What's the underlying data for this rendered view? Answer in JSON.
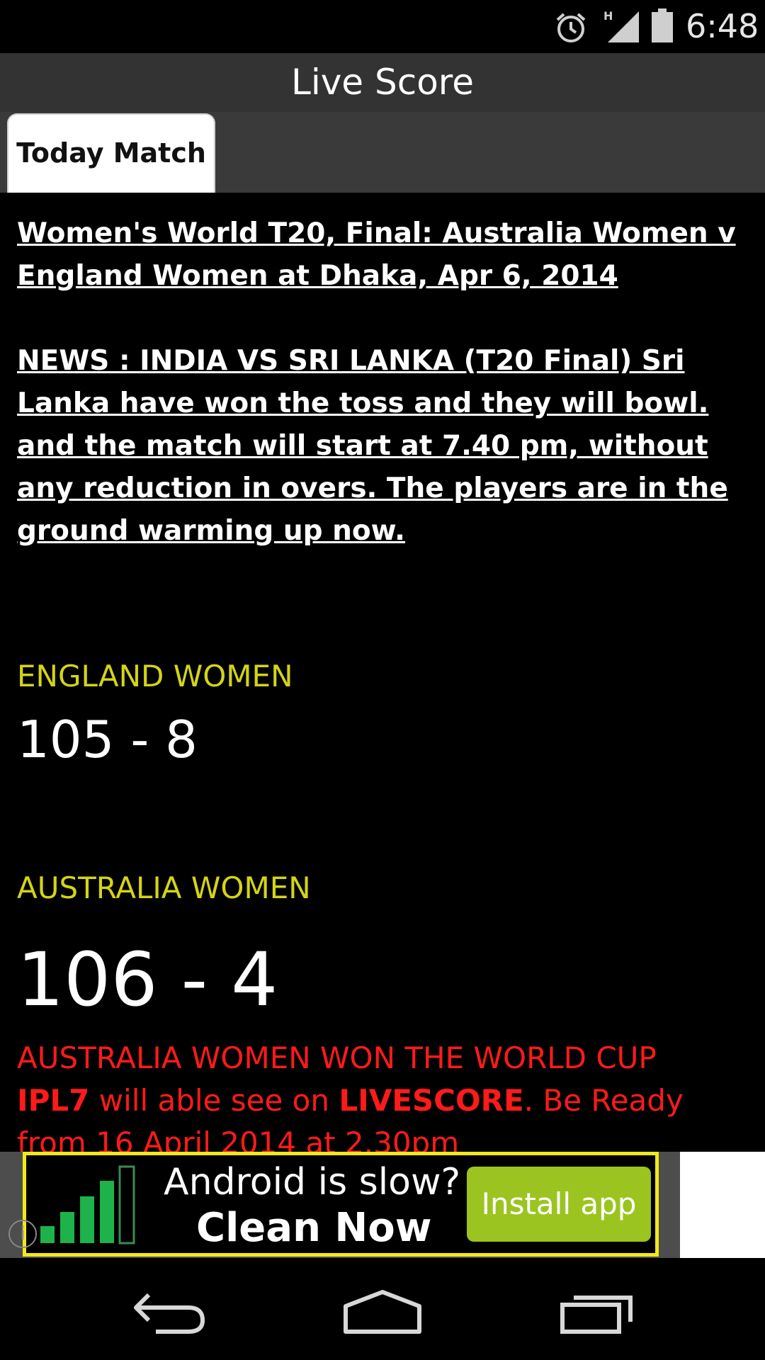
{
  "status_bar": {
    "time": "6:48",
    "network_label": "H",
    "icons": [
      "alarm-icon",
      "signal-icon",
      "battery-icon"
    ]
  },
  "action_bar": {
    "title": "Live Score"
  },
  "tabs": [
    {
      "label": "Today Match",
      "selected": true
    }
  ],
  "match": {
    "headline": "Women's World T20, Final: Australia Women v England Women at Dhaka, Apr 6, 2014",
    "news": "NEWS : INDIA VS SRI LANKA (T20 Final) Sri Lanka have won the toss and they will bowl. and the match will start at 7.40 pm, without any reduction in overs. The players are in the ground warming up now.",
    "team1": {
      "name": "ENGLAND WOMEN",
      "score": "105 - 8"
    },
    "team2": {
      "name": "AUSTRALIA WOMEN",
      "score": "106 - 4"
    },
    "result": "AUSTRALIA WOMEN WON THE WORLD CUP",
    "promo": {
      "part1": "IPL7",
      "part2": " will able see on ",
      "part3": "LIVESCORE",
      "part4": ". Be Ready from 16 April 2014 at 2.30pm"
    }
  },
  "ad": {
    "line1": "Android is slow?",
    "line2": "Clean Now",
    "button": "Install app",
    "info": "i"
  },
  "nav_bar": {
    "buttons": [
      "back-icon",
      "home-icon",
      "recent-apps-icon"
    ]
  },
  "colors": {
    "team_name": "#d4d416",
    "result": "#ff1a1a",
    "action_bar": "#333333",
    "ad_border": "#f2e81a",
    "install_button": "#9cc420"
  }
}
